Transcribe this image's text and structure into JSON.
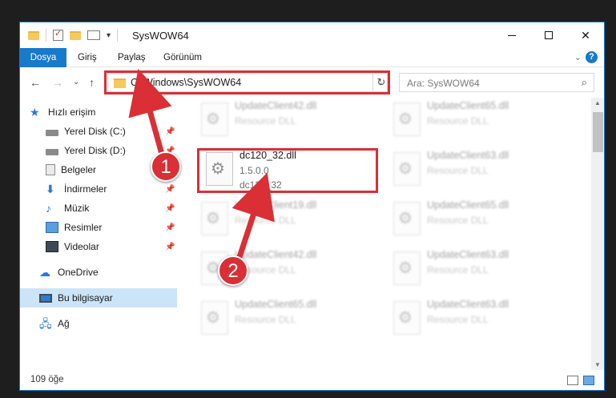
{
  "window": {
    "title": "SysWOW64"
  },
  "ribbon": {
    "tabs": [
      "Dosya",
      "Giriş",
      "Paylaş",
      "Görünüm"
    ]
  },
  "nav": {
    "address": "C:\\Windows\\SysWOW64",
    "search_placeholder": "Ara: SysWOW64"
  },
  "sidebar": {
    "items": [
      {
        "label": "Hızlı erişim",
        "icon": "star-icon"
      },
      {
        "label": "Yerel Disk (C:)",
        "icon": "disk-icon",
        "pinned": true
      },
      {
        "label": "Yerel Disk (D:)",
        "icon": "disk-icon",
        "pinned": true
      },
      {
        "label": "Belgeler",
        "icon": "documents-icon",
        "pinned": true
      },
      {
        "label": "İndirmeler",
        "icon": "downloads-icon",
        "pinned": true
      },
      {
        "label": "Müzik",
        "icon": "music-icon",
        "pinned": true
      },
      {
        "label": "Resimler",
        "icon": "pictures-icon",
        "pinned": true
      },
      {
        "label": "Videolar",
        "icon": "videos-icon",
        "pinned": true
      },
      {
        "label": "OneDrive",
        "icon": "cloud-icon"
      },
      {
        "label": "Bu bilgisayar",
        "icon": "computer-icon",
        "selected": true
      },
      {
        "label": "Ağ",
        "icon": "network-icon"
      }
    ]
  },
  "files": {
    "highlighted": {
      "name": "dc120_32.dll",
      "version": "1.5.0.0",
      "description": "dc120_32"
    },
    "blurred": [
      {
        "name": "UpdateClient42.dll",
        "type": "Resource DLL"
      },
      {
        "name": "UpdateClient65.dll",
        "type": "Resource DLL"
      },
      {
        "name": "UpdateClient63.dll",
        "type": "Resource DLL"
      },
      {
        "name": "UpdateClient19.dll",
        "type": "Resource DLL"
      },
      {
        "name": "UpdateClient65.dll",
        "type": "Resource DLL"
      },
      {
        "name": "UpdateClient42.dll",
        "type": "Resource DLL"
      },
      {
        "name": "UpdateClient63.dll",
        "type": "Resource DLL"
      },
      {
        "name": "UpdateClient65.dll",
        "type": "Resource DLL"
      },
      {
        "name": "UpdateClient63.dll",
        "type": "Resource DLL"
      }
    ]
  },
  "status": {
    "item_count": "109 öğe"
  },
  "callouts": {
    "step1": "1",
    "step2": "2"
  },
  "colors": {
    "accent": "#1979ca",
    "highlight": "#d92f35",
    "selected_bg": "#cce4f7"
  }
}
